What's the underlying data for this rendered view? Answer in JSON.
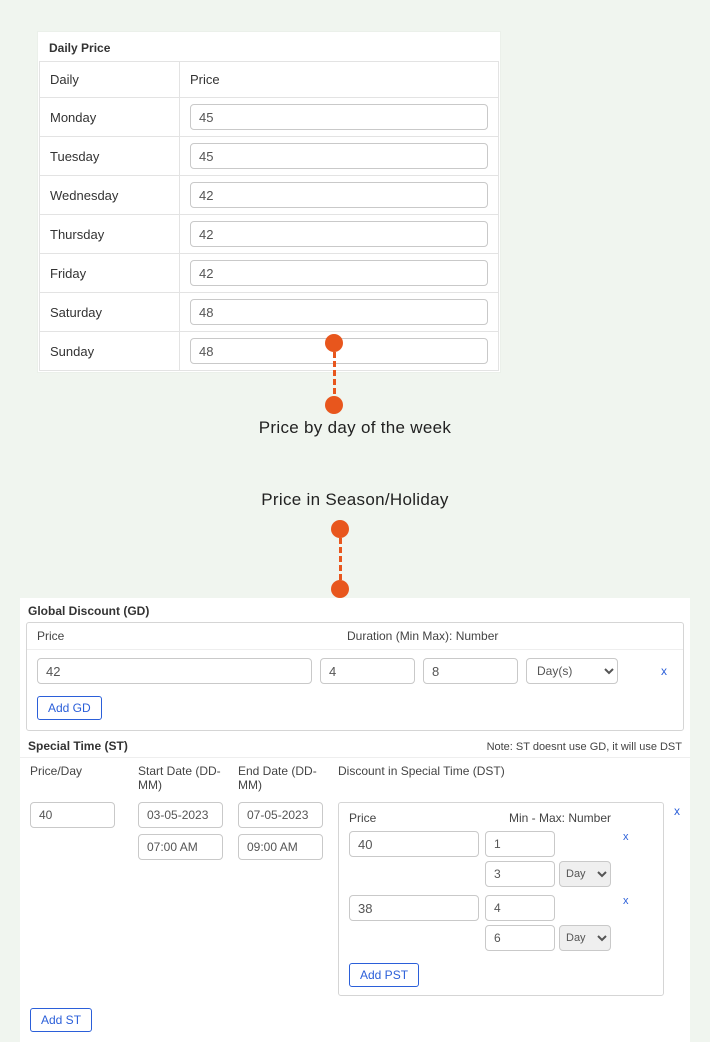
{
  "daily_price": {
    "title": "Daily Price",
    "col_day": "Daily",
    "col_price": "Price",
    "rows": [
      {
        "day": "Monday",
        "price": "45"
      },
      {
        "day": "Tuesday",
        "price": "45"
      },
      {
        "day": "Wednesday",
        "price": "42"
      },
      {
        "day": "Thursday",
        "price": "42"
      },
      {
        "day": "Friday",
        "price": "42"
      },
      {
        "day": "Saturday",
        "price": "48"
      },
      {
        "day": "Sunday",
        "price": "48"
      }
    ]
  },
  "captions": {
    "by_day": "Price by day of the week",
    "season": "Price in Season/Holiday"
  },
  "gd": {
    "title": "Global Discount (GD)",
    "col_price": "Price",
    "col_duration": "Duration (Min Max): Number",
    "row": {
      "price": "42",
      "min": "4",
      "max": "8",
      "unit": "Day(s)"
    },
    "remove": "x",
    "add": "Add GD"
  },
  "st": {
    "title": "Special Time (ST)",
    "note": "Note: ST doesnt use GD, it will use DST",
    "cols": {
      "price_day": "Price/Day",
      "start": "Start Date (DD-MM)",
      "end": "End Date (DD-MM)",
      "dst": "Discount in Special Time (DST)"
    },
    "row": {
      "price_day": "40",
      "start_date": "03-05-2023",
      "start_time": "07:00 AM",
      "end_date": "07-05-2023",
      "end_time": "09:00 AM"
    },
    "dst": {
      "col_price": "Price",
      "col_minmax": "Min - Max: Number",
      "rows": [
        {
          "price": "40",
          "min": "1",
          "max": "3",
          "unit": "Day"
        },
        {
          "price": "38",
          "min": "4",
          "max": "6",
          "unit": "Day"
        }
      ],
      "remove": "x",
      "add": "Add PST"
    },
    "remove": "x",
    "add": "Add ST"
  }
}
